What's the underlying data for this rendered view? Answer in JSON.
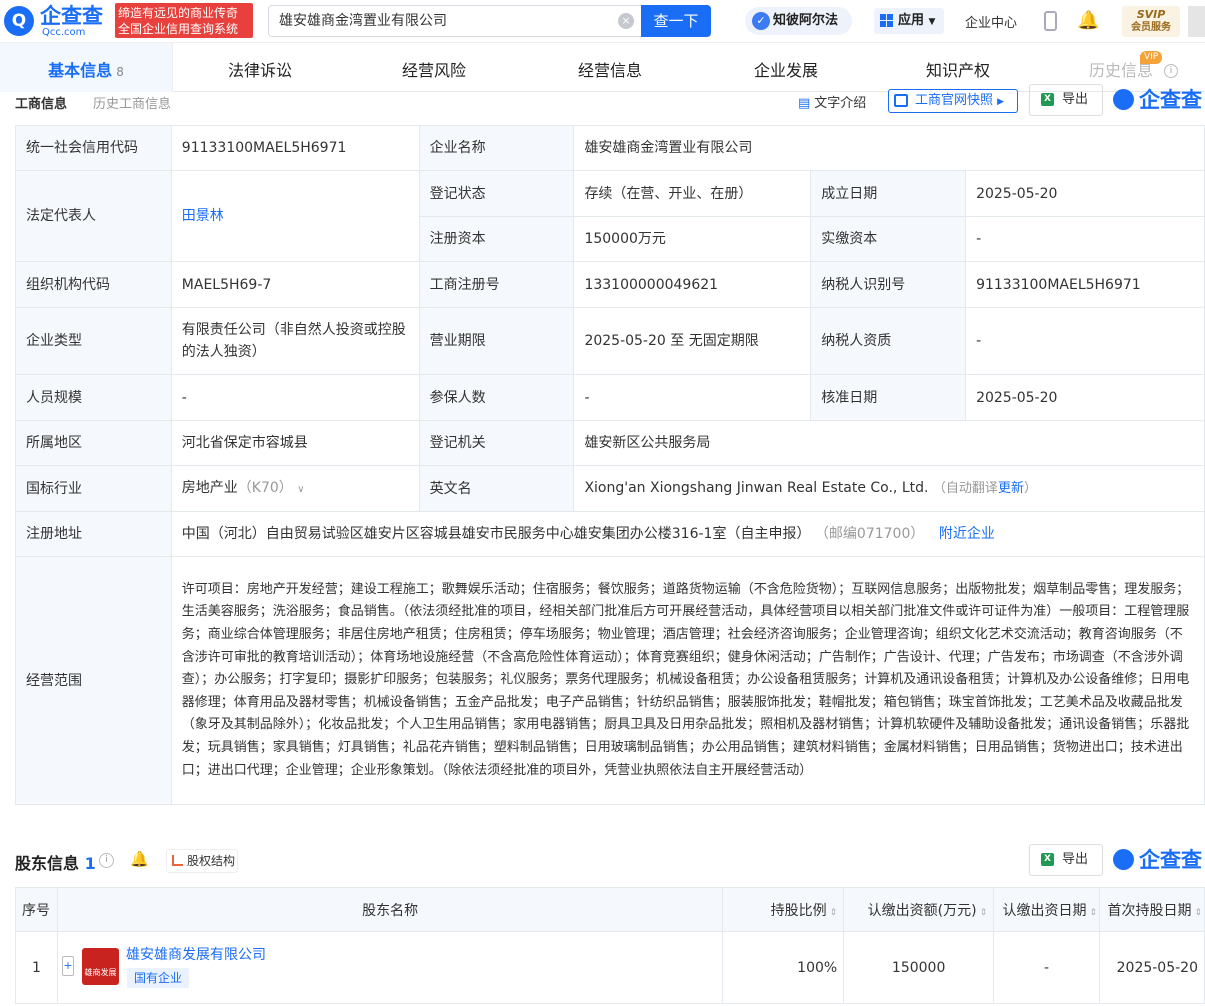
{
  "header": {
    "logo_glyph": "Q",
    "logo_name": "企查查",
    "logo_sub": "Qcc.com",
    "slogan_line1": "缔造有远见的商业传奇",
    "slogan_line2": "全国企业信用查询系统",
    "search_value": "雄安雄商金湾置业有限公司",
    "search_button": "查一下",
    "ai_button": "知彼阿尔法",
    "ai_glyph": "✓",
    "app_button": "应用",
    "center_link": "企业中心",
    "svip_line1": "SVIP",
    "svip_line2": "会员服务"
  },
  "tabs": [
    {
      "label": "基本信息",
      "count": "8"
    },
    {
      "label": "法律诉讼"
    },
    {
      "label": "经营风险"
    },
    {
      "label": "经营信息"
    },
    {
      "label": "企业发展"
    },
    {
      "label": "知识产权"
    },
    {
      "label": "历史信息",
      "badge": "VIP"
    }
  ],
  "subtabs": {
    "active": "工商信息",
    "other": "历史工商信息"
  },
  "actions": {
    "text_intro": "文字介绍",
    "snapshot": "工商官网快照",
    "export": "导出",
    "brand": "企查查"
  },
  "info": {
    "credit_code_label": "统一社会信用代码",
    "credit_code": "91133100MAEL5H6971",
    "company_name_label": "企业名称",
    "company_name": "雄安雄商金湾置业有限公司",
    "legal_rep_label": "法定代表人",
    "legal_rep": "田景林",
    "status_label": "登记状态",
    "status": "存续（在营、开业、在册）",
    "established_label": "成立日期",
    "established": "2025-05-20",
    "reg_capital_label": "注册资本",
    "reg_capital": "150000万元",
    "paid_capital_label": "实缴资本",
    "paid_capital": "-",
    "org_code_label": "组织机构代码",
    "org_code": "MAEL5H69-7",
    "reg_no_label": "工商注册号",
    "reg_no": "133100000049621",
    "tax_id_label": "纳税人识别号",
    "tax_id": "91133100MAEL5H6971",
    "type_label": "企业类型",
    "type": "有限责任公司（非自然人投资或控股的法人独资）",
    "term_label": "营业期限",
    "term": "2025-05-20 至 无固定期限",
    "tax_qual_label": "纳税人资质",
    "tax_qual": "-",
    "staff_label": "人员规模",
    "staff": "-",
    "insured_label": "参保人数",
    "insured": "-",
    "approved_label": "核准日期",
    "approved": "2025-05-20",
    "region_label": "所属地区",
    "region": "河北省保定市容城县",
    "authority_label": "登记机关",
    "authority": "雄安新区公共服务局",
    "industry_label": "国标行业",
    "industry": "房地产业",
    "industry_code": "（K70）",
    "en_name_label": "英文名",
    "en_name": "Xiong'an Xiongshang Jinwan Real Estate Co., Ltd.",
    "en_note": "（自动翻译",
    "en_update": "更新",
    "en_note_end": "）",
    "address_label": "注册地址",
    "address": "中国（河北）自由贸易试验区雄安片区容城县雄安市民服务中心雄安集团办公楼316-1室（自主申报）",
    "postcode": "（邮编071700）",
    "nearby": "附近企业",
    "scope_label": "经营范围",
    "scope": "许可项目：房地产开发经营；建设工程施工；歌舞娱乐活动；住宿服务；餐饮服务；道路货物运输（不含危险货物）；互联网信息服务；出版物批发；烟草制品零售；理发服务；生活美容服务；洗浴服务；食品销售。（依法须经批准的项目，经相关部门批准后方可开展经营活动，具体经营项目以相关部门批准文件或许可证件为准）一般项目：工程管理服务；商业综合体管理服务；非居住房地产租赁；住房租赁；停车场服务；物业管理；酒店管理；社会经济咨询服务；企业管理咨询；组织文化艺术交流活动；教育咨询服务（不含涉许可审批的教育培训活动）；体育场地设施经营（不含高危险性体育运动）；体育竞赛组织；健身休闲活动；广告制作；广告设计、代理；广告发布；市场调查（不含涉外调查）；办公服务；打字复印；摄影扩印服务；包装服务；礼仪服务；票务代理服务；机械设备租赁；办公设备租赁服务；计算机及通讯设备租赁；计算机及办公设备维修；日用电器修理；体育用品及器材零售；机械设备销售；五金产品批发；电子产品销售；针纺织品销售；服装服饰批发；鞋帽批发；箱包销售；珠宝首饰批发；工艺美术品及收藏品批发（象牙及其制品除外）；化妆品批发；个人卫生用品销售；家用电器销售；厨具卫具及日用杂品批发；照相机及器材销售；计算机软硬件及辅助设备批发；通讯设备销售；乐器批发；玩具销售；家具销售；灯具销售；礼品花卉销售；塑料制品销售；日用玻璃制品销售；办公用品销售；建筑材料销售；金属材料销售；日用品销售；货物进出口；技术进出口；进出口代理；企业管理；企业形象策划。（除依法须经批准的项目外，凭营业执照依法自主开展经营活动）"
  },
  "shareholders": {
    "title": "股东信息",
    "count": "1",
    "structure_button": "股权结构",
    "export": "导出",
    "brand": "企查查",
    "columns": [
      "序号",
      "股东名称",
      "持股比例",
      "认缴出资额(万元)",
      "认缴出资日期",
      "首次持股日期"
    ],
    "rows": [
      {
        "no": "1",
        "name": "雄安雄商发展有限公司",
        "tag": "国有企业",
        "logo_text": "雄商发展公司",
        "ratio": "100%",
        "amount": "150000",
        "date": "-",
        "first_date": "2025-05-20"
      }
    ]
  }
}
